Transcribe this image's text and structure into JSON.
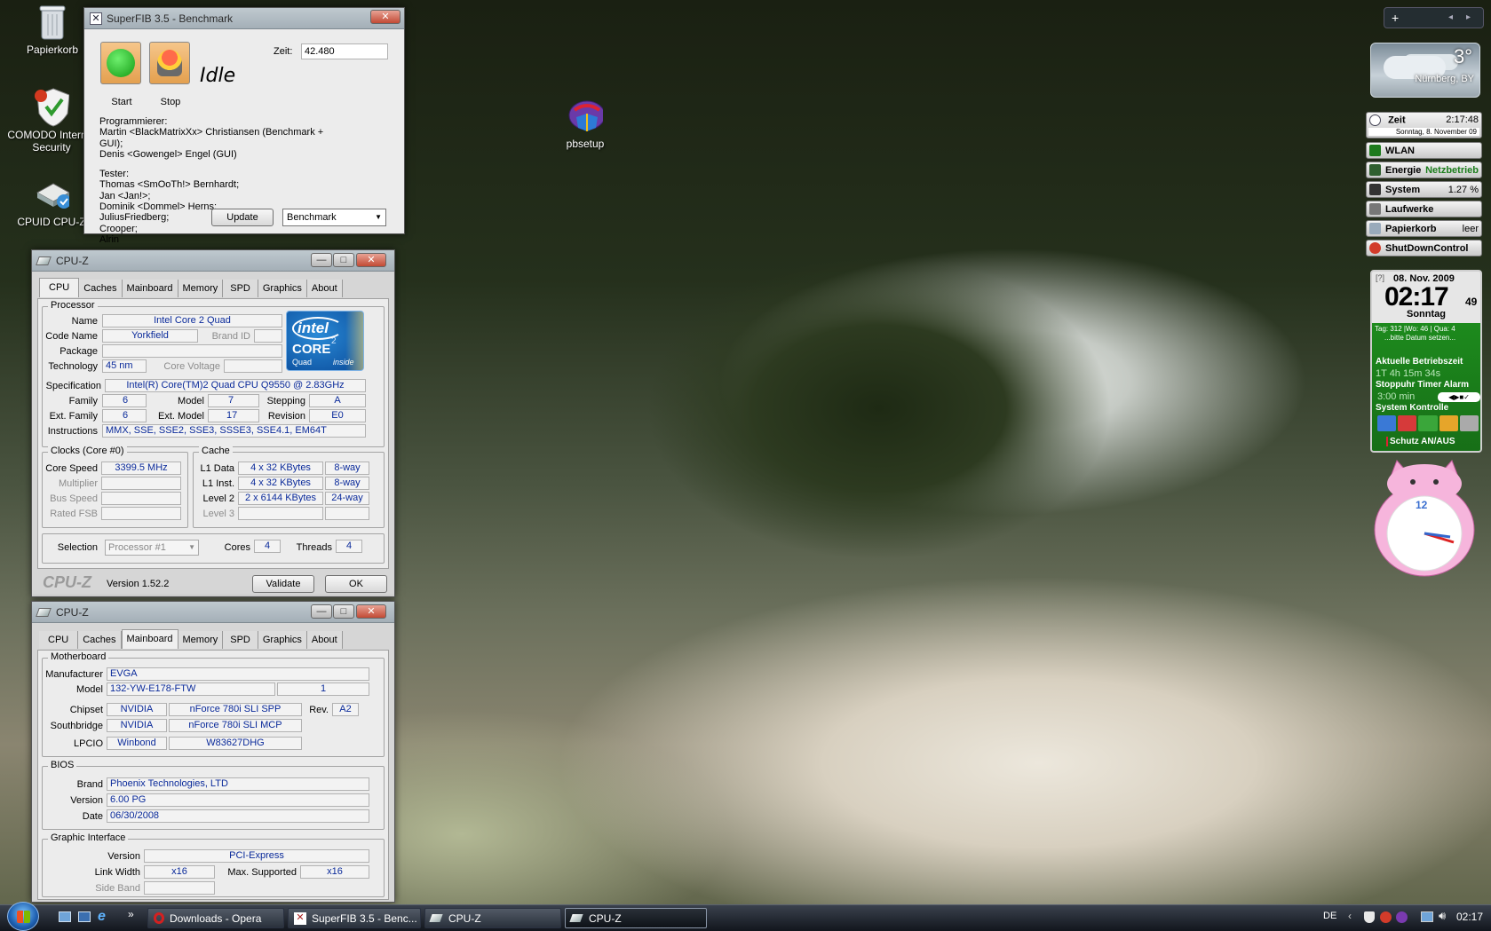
{
  "desktop": {
    "icons": [
      {
        "label": "Papierkorb"
      },
      {
        "label": "COMODO Internet Security"
      },
      {
        "label": "CPUID CPU-Z"
      },
      {
        "label": "pbsetup"
      }
    ]
  },
  "superfib": {
    "title": "SuperFIB 3.5 - Benchmark",
    "start_label": "Start",
    "stop_label": "Stop",
    "status": "Idle",
    "zeit_label": "Zeit:",
    "zeit_value": "42.480",
    "credits": [
      "Programmierer:",
      "Martin <BlackMatrixXx> Christiansen (Benchmark + GUI);",
      "Denis <Gowengel> Engel (GUI)",
      "",
      "Tester:",
      "Thomas <SmOoTh!> Bernhardt;",
      "Jan <Jan!>;",
      "Dominik <Dommel> Herns;",
      "JuliusFriedberg;",
      "Crooper;",
      "Alrin"
    ],
    "update_label": "Update",
    "mode_value": "Benchmark"
  },
  "cpuz1": {
    "title": "CPU-Z",
    "tabs": [
      "CPU",
      "Caches",
      "Mainboard",
      "Memory",
      "SPD",
      "Graphics",
      "About"
    ],
    "processor_group": "Processor",
    "name_label": "Name",
    "name_value": "Intel Core 2 Quad",
    "codename_label": "Code Name",
    "codename_value": "Yorkfield",
    "brandid_label": "Brand ID",
    "package_label": "Package",
    "technology_label": "Technology",
    "technology_value": "45 nm",
    "corevoltage_label": "Core Voltage",
    "spec_label": "Specification",
    "spec_value": "Intel(R) Core(TM)2 Quad CPU    Q9550  @ 2.83GHz",
    "family_label": "Family",
    "family_value": "6",
    "model_label": "Model",
    "model_value": "7",
    "stepping_label": "Stepping",
    "stepping_value": "A",
    "extfamily_label": "Ext. Family",
    "extfamily_value": "6",
    "extmodel_label": "Ext. Model",
    "extmodel_value": "17",
    "revision_label": "Revision",
    "revision_value": "E0",
    "instructions_label": "Instructions",
    "instructions_value": "MMX, SSE, SSE2, SSE3, SSSE3, SSE4.1, EM64T",
    "clocks_group": "Clocks (Core #0)",
    "corespeed_label": "Core Speed",
    "corespeed_value": "3399.5 MHz",
    "multiplier_label": "Multiplier",
    "busspeed_label": "Bus Speed",
    "ratedfsb_label": "Rated FSB",
    "cache_group": "Cache",
    "l1data_label": "L1 Data",
    "l1data_value": "4 x 32 KBytes",
    "l1data_way": "8-way",
    "l1inst_label": "L1 Inst.",
    "l1inst_value": "4 x 32 KBytes",
    "l1inst_way": "8-way",
    "level2_label": "Level 2",
    "level2_value": "2 x 6144 KBytes",
    "level2_way": "24-way",
    "level3_label": "Level 3",
    "selection_label": "Selection",
    "selection_value": "Processor #1",
    "cores_label": "Cores",
    "cores_value": "4",
    "threads_label": "Threads",
    "threads_value": "4",
    "brand": "CPU-Z",
    "version": "Version 1.52.2",
    "validate_label": "Validate",
    "ok_label": "OK",
    "logo": {
      "intel": "intel",
      "core": "CORE",
      "sup": "2",
      "quad": "Quad",
      "inside": "inside"
    }
  },
  "cpuz2": {
    "title": "CPU-Z",
    "tabs": [
      "CPU",
      "Caches",
      "Mainboard",
      "Memory",
      "SPD",
      "Graphics",
      "About"
    ],
    "motherboard_group": "Motherboard",
    "manufacturer_label": "Manufacturer",
    "manufacturer_value": "EVGA",
    "model_label": "Model",
    "model_value": "132-YW-E178-FTW",
    "model_rev": "1",
    "chipset_label": "Chipset",
    "chipset_vendor": "NVIDIA",
    "chipset_value": "nForce 780i SLI SPP",
    "rev_label": "Rev.",
    "rev_value": "A2",
    "southbridge_label": "Southbridge",
    "southbridge_vendor": "NVIDIA",
    "southbridge_value": "nForce 780i SLI MCP",
    "lpcio_label": "LPCIO",
    "lpcio_vendor": "Winbond",
    "lpcio_value": "W83627DHG",
    "bios_group": "BIOS",
    "brand_label": "Brand",
    "brand_value": "Phoenix Technologies, LTD",
    "version_label": "Version",
    "version_value": "6.00 PG",
    "date_label": "Date",
    "date_value": "06/30/2008",
    "graphic_group": "Graphic Interface",
    "gversion_label": "Version",
    "gversion_value": "PCI-Express",
    "linkwidth_label": "Link Width",
    "linkwidth_value": "x16",
    "maxsupported_label": "Max. Supported",
    "maxsupported_value": "x16",
    "sideband_label": "Side Band"
  },
  "sidebar": {
    "weather": {
      "temp": "3°",
      "city": "Nürnberg, BY"
    },
    "zeit": {
      "label": "Zeit",
      "time": "2:17:48",
      "date": "Sonntag, 8. November 09"
    },
    "wlan": {
      "label": "WLAN"
    },
    "energie": {
      "label": "Energie",
      "value": "Netzbetrieb"
    },
    "system": {
      "label": "System",
      "value": "1.27 %"
    },
    "laufwerke": {
      "label": "Laufwerke"
    },
    "papierkorb": {
      "label": "Papierkorb",
      "value": "leer"
    },
    "shutdown": {
      "label": "ShutDownControl"
    },
    "clock": {
      "help": "[?]",
      "date": "08. Nov. 2009",
      "time": "02:17",
      "seconds": "49",
      "day": "Sonntag",
      "info1": "Tag: 312 |Wo: 46 | Qua: 4",
      "info2": "...bitte Datum setzen...",
      "uptime_title": "Aktuelle Betriebszeit",
      "uptime": "1T 4h 15m 34s",
      "stopwatch": "Stoppuhr Timer Alarm",
      "timer_value": "3:00 min",
      "system_kontrolle": "System Kontrolle",
      "schutz": "Schutz AN/AUS"
    },
    "analog_clock": {
      "numeral": "12"
    }
  },
  "taskbar": {
    "items": [
      "Downloads - Opera",
      "SuperFIB 3.5 - Benc...",
      "CPU-Z",
      "CPU-Z"
    ],
    "lang": "DE",
    "time": "02:17",
    "chevron": "»"
  },
  "colors": {
    "taskbar": "#1c222c",
    "cpuz_value": "#0a2a9a",
    "sidebar_green": "#1b7d1b"
  }
}
